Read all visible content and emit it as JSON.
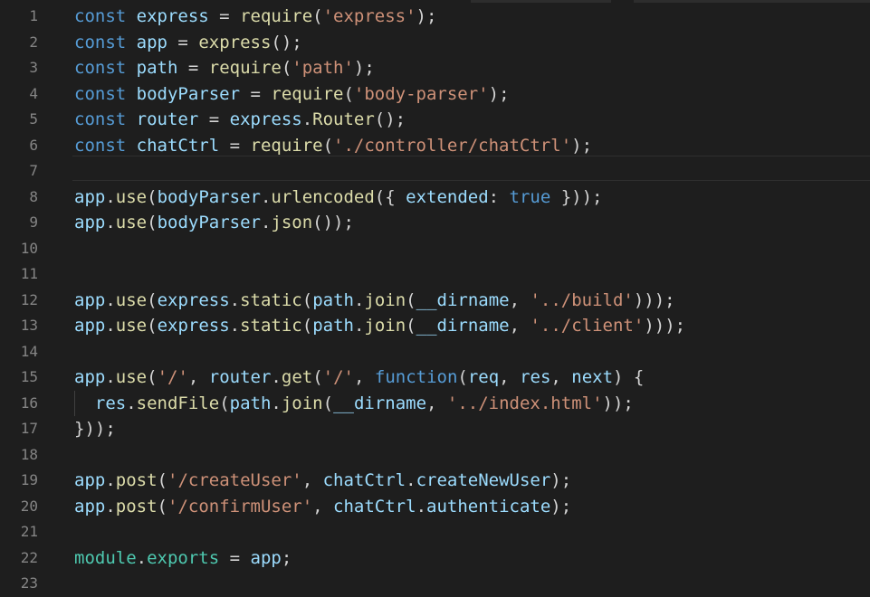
{
  "editor": {
    "language": "javascript",
    "colors": {
      "background": "#1e1e1e",
      "keyword": "#569cd6",
      "variable": "#9cdcfe",
      "function": "#dcdcaa",
      "string": "#ce9178",
      "module": "#4ec9b0",
      "line_number": "#858585"
    },
    "lines": [
      {
        "num": "1",
        "tokens": [
          {
            "t": "kw",
            "v": "const"
          },
          {
            "t": "pun",
            "v": " "
          },
          {
            "t": "var",
            "v": "express"
          },
          {
            "t": "pun",
            "v": " = "
          },
          {
            "t": "fn",
            "v": "require"
          },
          {
            "t": "pun",
            "v": "("
          },
          {
            "t": "str",
            "v": "'express'"
          },
          {
            "t": "pun",
            "v": ");"
          }
        ]
      },
      {
        "num": "2",
        "tokens": [
          {
            "t": "kw",
            "v": "const"
          },
          {
            "t": "pun",
            "v": " "
          },
          {
            "t": "var",
            "v": "app"
          },
          {
            "t": "pun",
            "v": " = "
          },
          {
            "t": "fn",
            "v": "express"
          },
          {
            "t": "pun",
            "v": "();"
          }
        ]
      },
      {
        "num": "3",
        "tokens": [
          {
            "t": "kw",
            "v": "const"
          },
          {
            "t": "pun",
            "v": " "
          },
          {
            "t": "var",
            "v": "path"
          },
          {
            "t": "pun",
            "v": " = "
          },
          {
            "t": "fn",
            "v": "require"
          },
          {
            "t": "pun",
            "v": "("
          },
          {
            "t": "str",
            "v": "'path'"
          },
          {
            "t": "pun",
            "v": ");"
          }
        ]
      },
      {
        "num": "4",
        "tokens": [
          {
            "t": "kw",
            "v": "const"
          },
          {
            "t": "pun",
            "v": " "
          },
          {
            "t": "var",
            "v": "bodyParser"
          },
          {
            "t": "pun",
            "v": " = "
          },
          {
            "t": "fn",
            "v": "require"
          },
          {
            "t": "pun",
            "v": "("
          },
          {
            "t": "str",
            "v": "'body-parser'"
          },
          {
            "t": "pun",
            "v": ");"
          }
        ]
      },
      {
        "num": "5",
        "tokens": [
          {
            "t": "kw",
            "v": "const"
          },
          {
            "t": "pun",
            "v": " "
          },
          {
            "t": "var",
            "v": "router"
          },
          {
            "t": "pun",
            "v": " = "
          },
          {
            "t": "var",
            "v": "express"
          },
          {
            "t": "pun",
            "v": "."
          },
          {
            "t": "fn",
            "v": "Router"
          },
          {
            "t": "pun",
            "v": "();"
          }
        ]
      },
      {
        "num": "6",
        "tokens": [
          {
            "t": "kw",
            "v": "const"
          },
          {
            "t": "pun",
            "v": " "
          },
          {
            "t": "var",
            "v": "chatCtrl"
          },
          {
            "t": "pun",
            "v": " = "
          },
          {
            "t": "fn",
            "v": "require"
          },
          {
            "t": "pun",
            "v": "("
          },
          {
            "t": "str",
            "v": "'./controller/chatCtrl'"
          },
          {
            "t": "pun",
            "v": ");"
          }
        ]
      },
      {
        "num": "7",
        "tokens": []
      },
      {
        "num": "8",
        "tokens": [
          {
            "t": "var",
            "v": "app"
          },
          {
            "t": "pun",
            "v": "."
          },
          {
            "t": "fn",
            "v": "use"
          },
          {
            "t": "pun",
            "v": "("
          },
          {
            "t": "var",
            "v": "bodyParser"
          },
          {
            "t": "pun",
            "v": "."
          },
          {
            "t": "fn",
            "v": "urlencoded"
          },
          {
            "t": "pun",
            "v": "({ "
          },
          {
            "t": "var",
            "v": "extended"
          },
          {
            "t": "pun",
            "v": ": "
          },
          {
            "t": "kw",
            "v": "true"
          },
          {
            "t": "pun",
            "v": " }));"
          }
        ]
      },
      {
        "num": "9",
        "tokens": [
          {
            "t": "var",
            "v": "app"
          },
          {
            "t": "pun",
            "v": "."
          },
          {
            "t": "fn",
            "v": "use"
          },
          {
            "t": "pun",
            "v": "("
          },
          {
            "t": "var",
            "v": "bodyParser"
          },
          {
            "t": "pun",
            "v": "."
          },
          {
            "t": "fn",
            "v": "json"
          },
          {
            "t": "pun",
            "v": "());"
          }
        ]
      },
      {
        "num": "10",
        "tokens": []
      },
      {
        "num": "11",
        "tokens": []
      },
      {
        "num": "12",
        "tokens": [
          {
            "t": "var",
            "v": "app"
          },
          {
            "t": "pun",
            "v": "."
          },
          {
            "t": "fn",
            "v": "use"
          },
          {
            "t": "pun",
            "v": "("
          },
          {
            "t": "var",
            "v": "express"
          },
          {
            "t": "pun",
            "v": "."
          },
          {
            "t": "fn",
            "v": "static"
          },
          {
            "t": "pun",
            "v": "("
          },
          {
            "t": "var",
            "v": "path"
          },
          {
            "t": "pun",
            "v": "."
          },
          {
            "t": "fn",
            "v": "join"
          },
          {
            "t": "pun",
            "v": "("
          },
          {
            "t": "var",
            "v": "__dirname"
          },
          {
            "t": "pun",
            "v": ", "
          },
          {
            "t": "str",
            "v": "'../build'"
          },
          {
            "t": "pun",
            "v": ")));"
          }
        ]
      },
      {
        "num": "13",
        "tokens": [
          {
            "t": "var",
            "v": "app"
          },
          {
            "t": "pun",
            "v": "."
          },
          {
            "t": "fn",
            "v": "use"
          },
          {
            "t": "pun",
            "v": "("
          },
          {
            "t": "var",
            "v": "express"
          },
          {
            "t": "pun",
            "v": "."
          },
          {
            "t": "fn",
            "v": "static"
          },
          {
            "t": "pun",
            "v": "("
          },
          {
            "t": "var",
            "v": "path"
          },
          {
            "t": "pun",
            "v": "."
          },
          {
            "t": "fn",
            "v": "join"
          },
          {
            "t": "pun",
            "v": "("
          },
          {
            "t": "var",
            "v": "__dirname"
          },
          {
            "t": "pun",
            "v": ", "
          },
          {
            "t": "str",
            "v": "'../client'"
          },
          {
            "t": "pun",
            "v": ")));"
          }
        ]
      },
      {
        "num": "14",
        "tokens": []
      },
      {
        "num": "15",
        "tokens": [
          {
            "t": "var",
            "v": "app"
          },
          {
            "t": "pun",
            "v": "."
          },
          {
            "t": "fn",
            "v": "use"
          },
          {
            "t": "pun",
            "v": "("
          },
          {
            "t": "str",
            "v": "'/'"
          },
          {
            "t": "pun",
            "v": ", "
          },
          {
            "t": "var",
            "v": "router"
          },
          {
            "t": "pun",
            "v": "."
          },
          {
            "t": "fn",
            "v": "get"
          },
          {
            "t": "pun",
            "v": "("
          },
          {
            "t": "str",
            "v": "'/'"
          },
          {
            "t": "pun",
            "v": ", "
          },
          {
            "t": "kw",
            "v": "function"
          },
          {
            "t": "pun",
            "v": "("
          },
          {
            "t": "var",
            "v": "req"
          },
          {
            "t": "pun",
            "v": ", "
          },
          {
            "t": "var",
            "v": "res"
          },
          {
            "t": "pun",
            "v": ", "
          },
          {
            "t": "var",
            "v": "next"
          },
          {
            "t": "pun",
            "v": ") {"
          }
        ]
      },
      {
        "num": "16",
        "tokens": [
          {
            "t": "pun",
            "v": "  "
          },
          {
            "t": "var",
            "v": "res"
          },
          {
            "t": "pun",
            "v": "."
          },
          {
            "t": "fn",
            "v": "sendFile"
          },
          {
            "t": "pun",
            "v": "("
          },
          {
            "t": "var",
            "v": "path"
          },
          {
            "t": "pun",
            "v": "."
          },
          {
            "t": "fn",
            "v": "join"
          },
          {
            "t": "pun",
            "v": "("
          },
          {
            "t": "var",
            "v": "__dirname"
          },
          {
            "t": "pun",
            "v": ", "
          },
          {
            "t": "str",
            "v": "'../index.html'"
          },
          {
            "t": "pun",
            "v": "));"
          }
        ]
      },
      {
        "num": "17",
        "tokens": [
          {
            "t": "pun",
            "v": "}));"
          }
        ]
      },
      {
        "num": "18",
        "tokens": []
      },
      {
        "num": "19",
        "tokens": [
          {
            "t": "var",
            "v": "app"
          },
          {
            "t": "pun",
            "v": "."
          },
          {
            "t": "fn",
            "v": "post"
          },
          {
            "t": "pun",
            "v": "("
          },
          {
            "t": "str",
            "v": "'/createUser'"
          },
          {
            "t": "pun",
            "v": ", "
          },
          {
            "t": "var",
            "v": "chatCtrl"
          },
          {
            "t": "pun",
            "v": "."
          },
          {
            "t": "var",
            "v": "createNewUser"
          },
          {
            "t": "pun",
            "v": ");"
          }
        ]
      },
      {
        "num": "20",
        "tokens": [
          {
            "t": "var",
            "v": "app"
          },
          {
            "t": "pun",
            "v": "."
          },
          {
            "t": "fn",
            "v": "post"
          },
          {
            "t": "pun",
            "v": "("
          },
          {
            "t": "str",
            "v": "'/confirmUser'"
          },
          {
            "t": "pun",
            "v": ", "
          },
          {
            "t": "var",
            "v": "chatCtrl"
          },
          {
            "t": "pun",
            "v": "."
          },
          {
            "t": "var",
            "v": "authenticate"
          },
          {
            "t": "pun",
            "v": ");"
          }
        ]
      },
      {
        "num": "21",
        "tokens": []
      },
      {
        "num": "22",
        "tokens": [
          {
            "t": "mod",
            "v": "module"
          },
          {
            "t": "pun",
            "v": "."
          },
          {
            "t": "mod",
            "v": "exports"
          },
          {
            "t": "pun",
            "v": " = "
          },
          {
            "t": "var",
            "v": "app"
          },
          {
            "t": "pun",
            "v": ";"
          }
        ]
      },
      {
        "num": "23",
        "tokens": []
      }
    ]
  }
}
